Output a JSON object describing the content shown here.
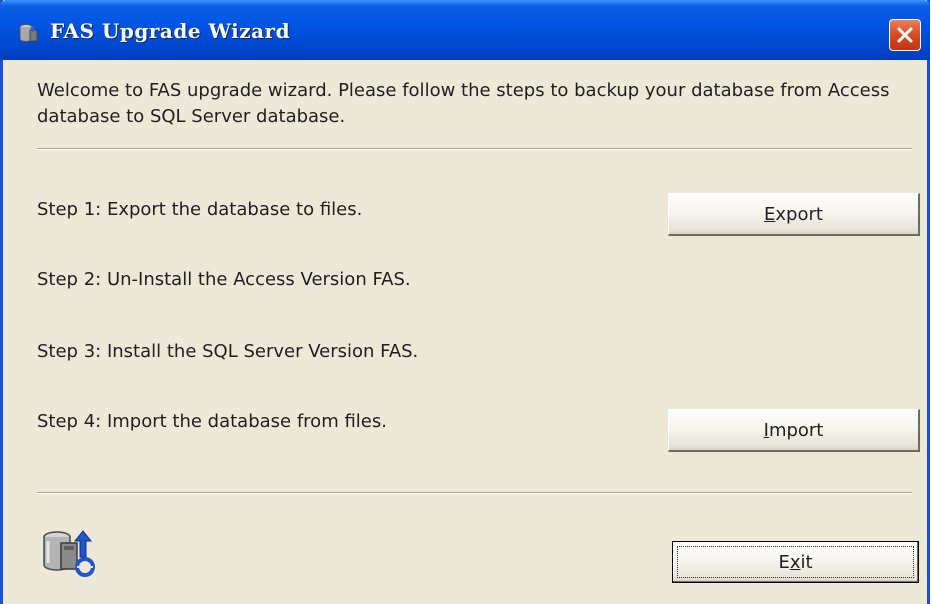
{
  "window": {
    "title": "FAS Upgrade Wizard",
    "icon": "database-icon",
    "close_icon": "close-icon"
  },
  "content": {
    "welcome": "Welcome to FAS upgrade wizard. Please follow the steps to backup your database from Access database to SQL Server database.",
    "steps": [
      "Step 1: Export the database to files.",
      "Step 2: Un-Install the Access Version FAS.",
      "Step 3: Install the SQL Server Version FAS.",
      "Step 4: Import the database from files."
    ]
  },
  "buttons": {
    "export": {
      "mnemonic": "E",
      "rest": "xport"
    },
    "import": {
      "mnemonic": "I",
      "rest": "mport"
    },
    "exit": {
      "pre": "E",
      "mnemonic": "x",
      "rest": "it"
    }
  },
  "footer": {
    "icon": "database-upgrade-icon"
  },
  "colors": {
    "title_bar": "#0054e3",
    "window_border": "#1a4fd8",
    "dialog_bg": "#ece9d8",
    "close_button": "#d74a22"
  }
}
